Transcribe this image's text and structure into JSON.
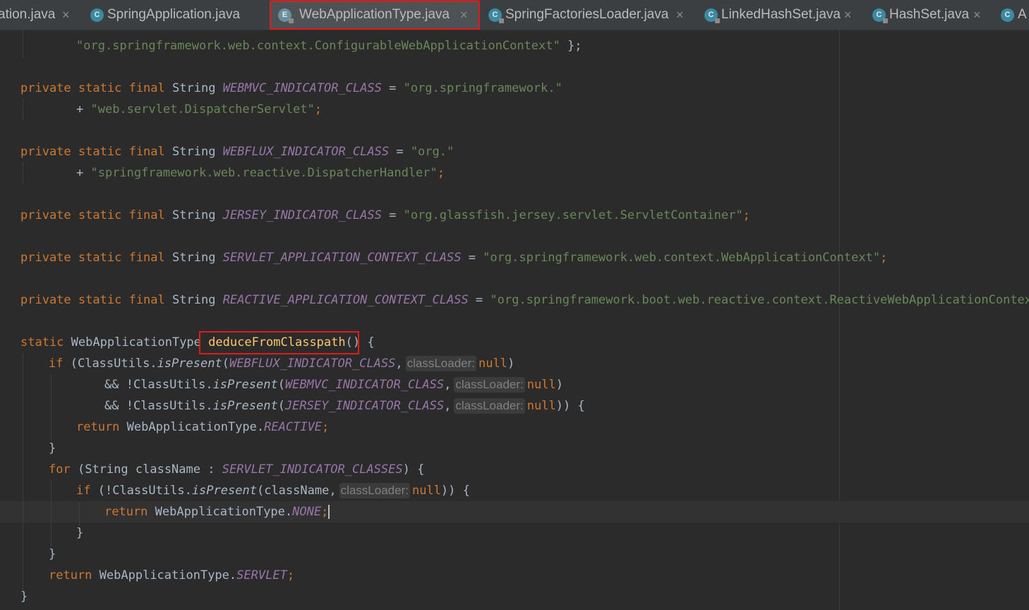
{
  "tabs": [
    {
      "label": "ation.java",
      "icon": "none"
    },
    {
      "label": "SpringApplication.java",
      "icon": "class-icon"
    },
    {
      "label": "WebApplicationType.java",
      "icon": "enum-icon"
    },
    {
      "label": "SpringFactoriesLoader.java",
      "icon": "class-icon"
    },
    {
      "label": "LinkedHashSet.java",
      "icon": "class-icon"
    },
    {
      "label": "HashSet.java",
      "icon": "class-icon"
    },
    {
      "label": "A",
      "icon": "class-icon"
    }
  ],
  "close_glyph": "×",
  "code": {
    "l1_str": "\"org.springframework.web.context.ConfigurableWebApplicationContext\"",
    "l1_end": " };",
    "kw_private": "private",
    "kw_static": "static",
    "kw_final": "final",
    "type_string": "String",
    "kw_if": "if",
    "kw_for": "for",
    "kw_return": "return",
    "kw_null": "null",
    "hint_label": "classLoader:",
    "webmvc_const": "WEBMVC_INDICATOR_CLASS",
    "webmvc_str1": "\"org.springframework.\"",
    "webmvc_str2": "\"web.servlet.DispatcherServlet\"",
    "webflux_const": "WEBFLUX_INDICATOR_CLASS",
    "webflux_str1": "\"org.\"",
    "webflux_str2": "\"springframework.web.reactive.DispatcherHandler\"",
    "jersey_const": "JERSEY_INDICATOR_CLASS",
    "jersey_str": "\"org.glassfish.jersey.servlet.ServletContainer\"",
    "servlet_ctx_const": "SERVLET_APPLICATION_CONTEXT_CLASS",
    "servlet_ctx_str": "\"org.springframework.web.context.WebApplicationContext\"",
    "reactive_ctx_const": "REACTIVE_APPLICATION_CONTEXT_CLASS",
    "reactive_ctx_str": "\"org.springframework.boot.web.reactive.context.ReactiveWebApplicationContext\"",
    "type_webapptype": "WebApplicationType",
    "method_name": "deduceFromClasspath",
    "class_utils": "ClassUtils",
    "is_present": "isPresent",
    "servlet_indicator_classes": "SERVLET_INDICATOR_CLASSES",
    "class_name": "className",
    "reactive": "REACTIVE",
    "none": "NONE",
    "servlet": "SERVLET"
  }
}
